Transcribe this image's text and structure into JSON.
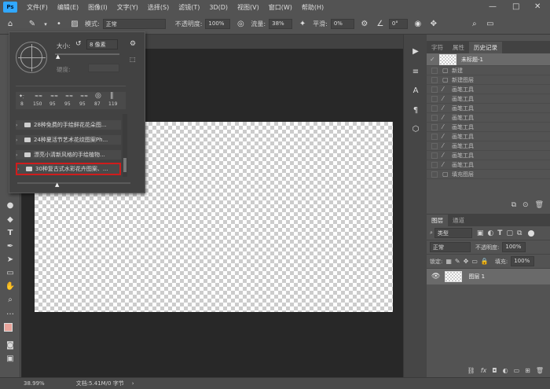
{
  "app": {
    "logo": "Ps"
  },
  "menu": [
    "文件(F)",
    "编辑(E)",
    "图像(I)",
    "文字(Y)",
    "选择(S)",
    "滤镜(T)",
    "3D(D)",
    "视图(V)",
    "窗口(W)",
    "帮助(H)"
  ],
  "window_controls": [
    "—",
    "□",
    "✕"
  ],
  "options": {
    "mode_label": "模式:",
    "mode_value": "正常",
    "opacity_label": "不透明度:",
    "opacity_value": "100%",
    "flow_label": "流量:",
    "flow_value": "38%",
    "smooth_label": "平滑:",
    "smooth_value": "0%",
    "angle_value": "0°"
  },
  "brush_panel": {
    "size_label": "大小:",
    "size_value": "8 像素",
    "hardness_label": "硬度:",
    "preset_sizes": [
      "8",
      "150",
      "95",
      "95",
      "95",
      "87",
      "119"
    ],
    "items": [
      "28种免费的手绘鲜花花朵图...",
      "24种夏活节艺术花纹图案Ph...",
      "漂亮小清新风格的手绘植物...",
      "30种复古式水彩花卉图案、..."
    ]
  },
  "history_panel": {
    "tabs": [
      "字符",
      "属性",
      "历史记录"
    ],
    "doc_name": "未标题-1",
    "items": [
      "新建",
      "新建图层",
      "画笔工具",
      "画笔工具",
      "画笔工具",
      "画笔工具",
      "画笔工具",
      "画笔工具",
      "画笔工具",
      "画笔工具",
      "画笔工具",
      "填充图层"
    ]
  },
  "layers_panel": {
    "tabs": [
      "图层",
      "通道"
    ],
    "filter_label": "类型",
    "blend_value": "正常",
    "opacity_label": "不透明度:",
    "opacity_value": "100%",
    "lock_label": "锁定:",
    "fill_label": "填充:",
    "fill_value": "100%",
    "layer_name": "图层 1"
  },
  "status": {
    "zoom": "38.99%",
    "doc_info": "文档:5.41M/0 字节"
  },
  "colors": {
    "foreground": "#e8a49b",
    "background": "#111111",
    "accent": "#d01c1c"
  }
}
